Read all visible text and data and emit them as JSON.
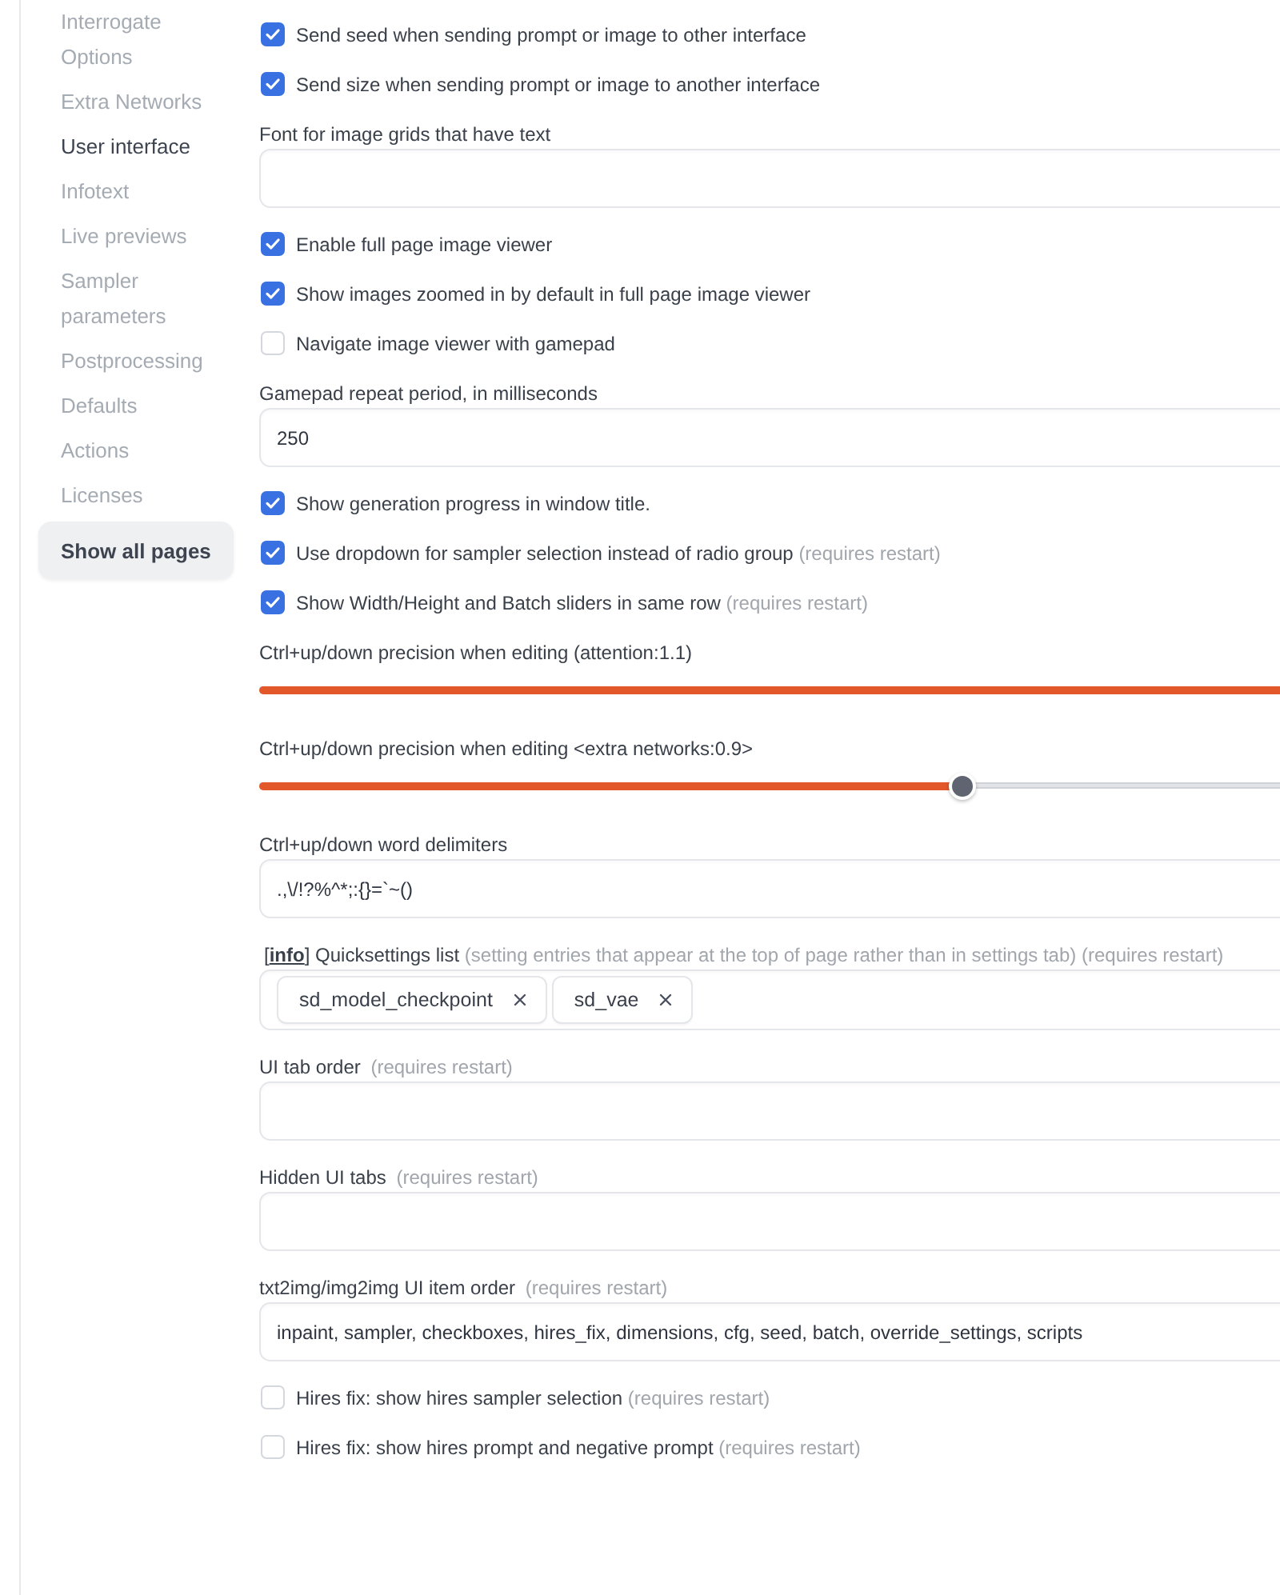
{
  "sidebar": {
    "items": [
      {
        "label": "Interrogate Options",
        "selected": false
      },
      {
        "label": "Extra Networks",
        "selected": false
      },
      {
        "label": "User interface",
        "selected": true
      },
      {
        "label": "Infotext",
        "selected": false
      },
      {
        "label": "Live previews",
        "selected": false
      },
      {
        "label": "Sampler parameters",
        "selected": false
      },
      {
        "label": "Postprocessing",
        "selected": false
      },
      {
        "label": "Defaults",
        "selected": false
      },
      {
        "label": "Actions",
        "selected": false
      },
      {
        "label": "Licenses",
        "selected": false
      }
    ],
    "show_all_button": "Show all pages"
  },
  "settings": [
    {
      "kind": "checkbox",
      "label": "Send seed when sending prompt or image to other interface",
      "checked": true
    },
    {
      "kind": "checkbox",
      "label": "Send size when sending prompt or image to another interface",
      "checked": true
    },
    {
      "kind": "text",
      "label": "Font for image grids that have text"
    },
    {
      "kind": "checkbox",
      "label": "Enable full page image viewer",
      "checked": true
    },
    {
      "kind": "checkbox",
      "label": "Show images zoomed in by default in full page image viewer",
      "checked": true
    },
    {
      "kind": "checkbox",
      "label": "Navigate image viewer with gamepad",
      "checked": false
    },
    {
      "kind": "text",
      "label": "Gamepad repeat period, in milliseconds",
      "value": "250"
    },
    {
      "kind": "checkbox",
      "label": "Show generation progress in window title.",
      "checked": true
    },
    {
      "kind": "checkbox",
      "label": "Use dropdown for sampler selection instead of radio group",
      "note": "(requires restart)",
      "checked": true
    },
    {
      "kind": "checkbox",
      "label": "Show Width/Height and Batch sliders in same row",
      "note": "(requires restart)",
      "checked": true
    },
    {
      "kind": "slider",
      "label": "Ctrl+up/down precision when editing (attention:1.1)",
      "level": 0.95
    },
    {
      "kind": "slider",
      "label": "Ctrl+up/down precision when editing <extra networks:0.9>",
      "level": 0.61
    },
    {
      "kind": "text",
      "label": "Ctrl+up/down word delimiters",
      "value": ".,\\/!?%^*;:{}=`~()"
    },
    {
      "kind": "multiselect",
      "link_open": "[",
      "link": "info",
      "link_close": "]",
      "label": "Quicksettings list",
      "note": "(setting entries that appear at the top of page rather than in settings tab) (requires restart)",
      "chips": [
        "sd_model_checkpoint",
        "sd_vae"
      ]
    },
    {
      "kind": "text",
      "label": "UI tab order",
      "note": "(requires restart)"
    },
    {
      "kind": "text",
      "label": "Hidden UI tabs",
      "note": "(requires restart)"
    },
    {
      "kind": "text",
      "label": "txt2img/img2img UI item order",
      "note": "(requires restart)",
      "value": "inpaint, sampler, checkboxes, hires_fix, dimensions, cfg, seed, batch, override_settings, scripts"
    },
    {
      "kind": "checkbox",
      "label": "Hires fix: show hires sampler selection",
      "note": "(requires restart)",
      "checked": false
    },
    {
      "kind": "checkbox",
      "label": "Hires fix: show hires prompt and negative prompt",
      "note": "(requires restart)",
      "checked": false
    }
  ]
}
